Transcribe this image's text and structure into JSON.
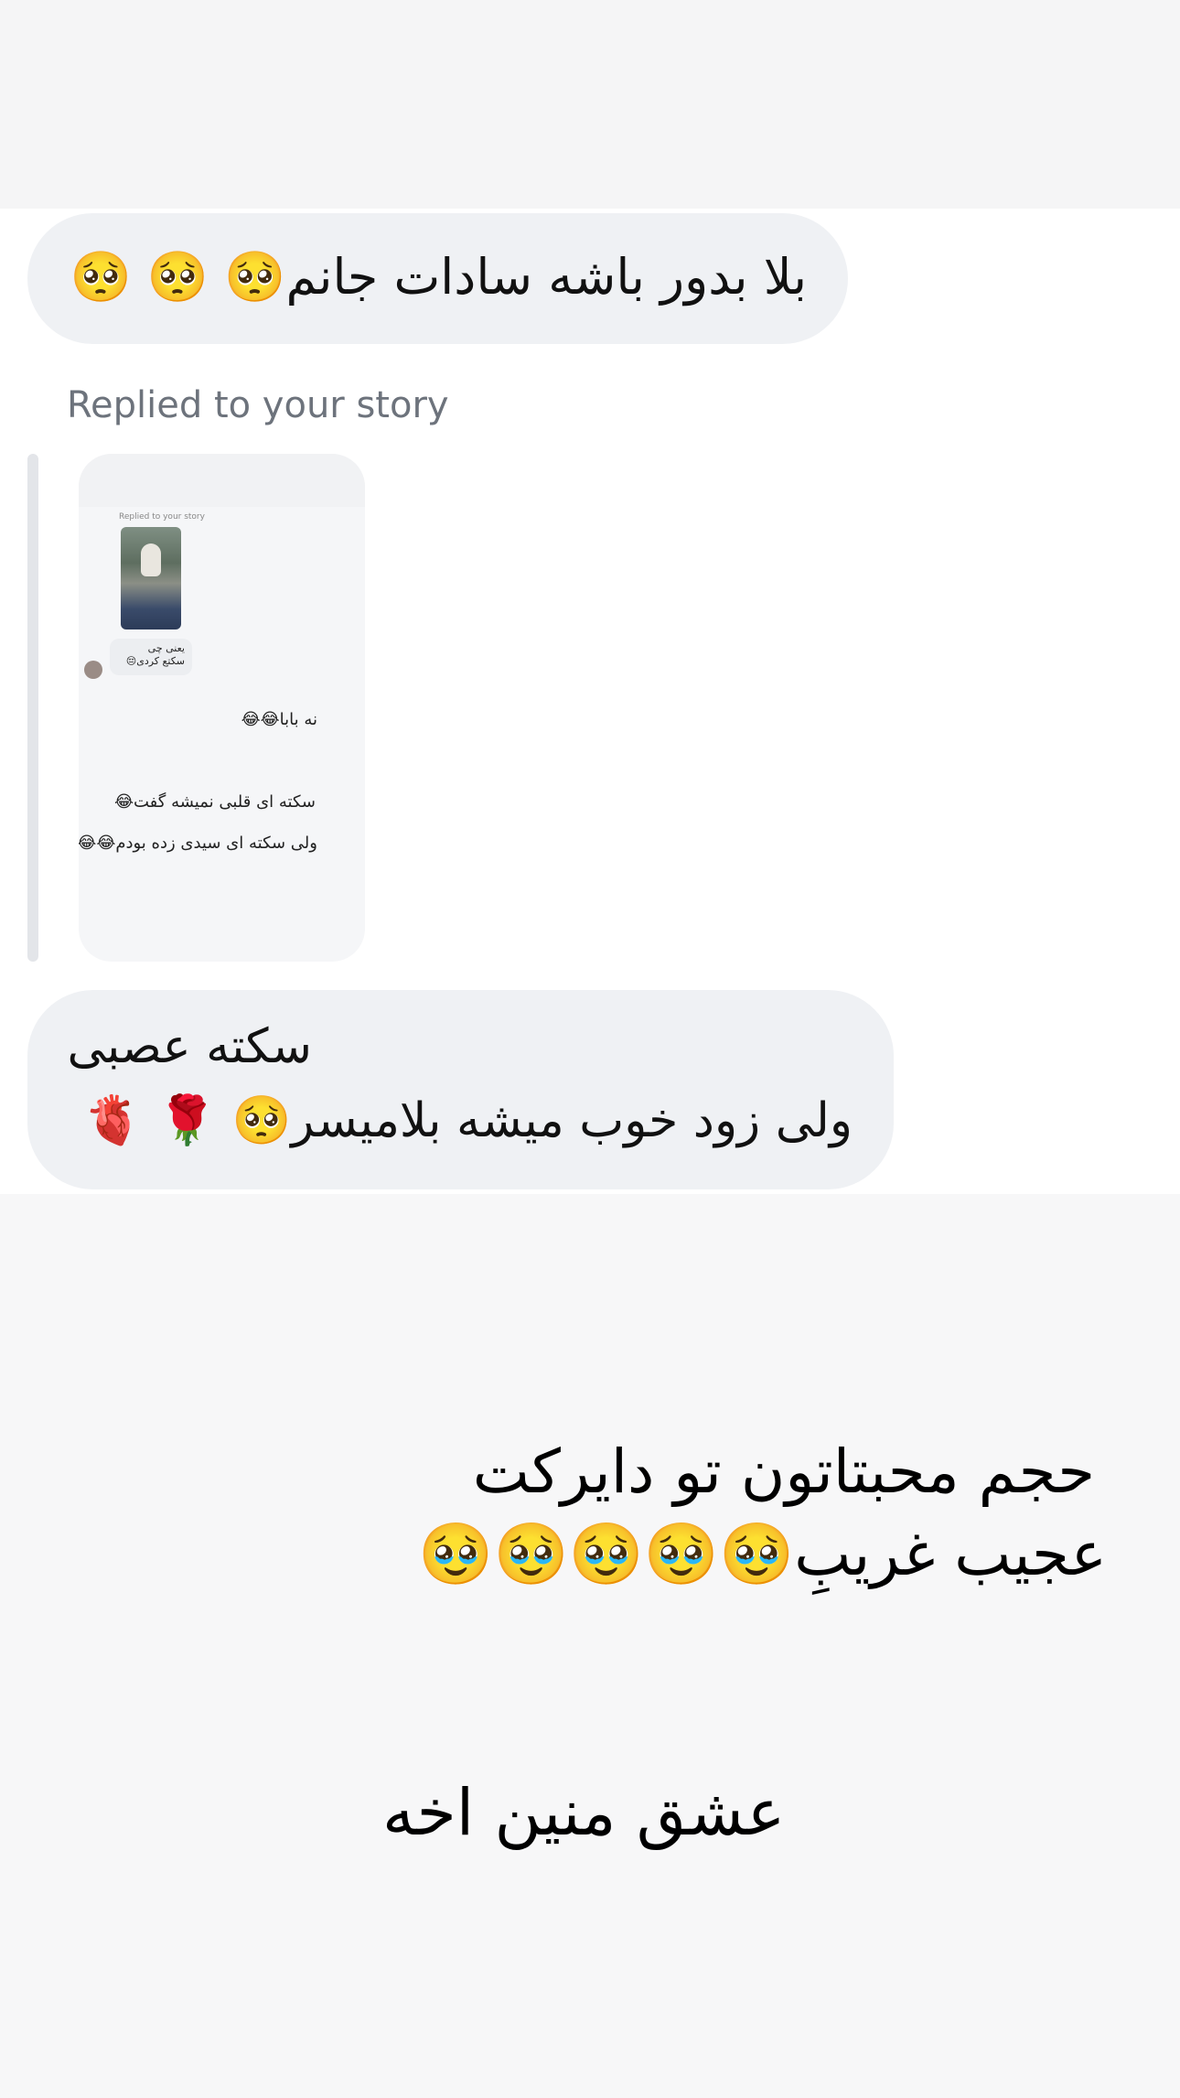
{
  "messages": [
    {
      "text": "بلا بدور باشه سادات جانم🥺 🥺 🥺"
    },
    {
      "line1": "سکته عصبی",
      "line2": "ولی زود خوب میشه بلامیسر🥺 🌹 🫀"
    }
  ],
  "story_reply": {
    "label": "Replied to your story",
    "preview": {
      "replied_label": "Replied to your story",
      "bubble_line1": "یعنی چی",
      "bubble_line2": "سکتع کردی😔",
      "line1": "نه بابا😂😂",
      "line2": "سکته ای قلبی نمیشه گفت😂",
      "line3": "ولی سکته ای سیدی زده بودم😂😂"
    }
  },
  "caption": {
    "line1": "حجم محبتاتون تو دایرکت",
    "line2": "عجیب غریبِ🥹🥹🥹🥹🥹",
    "line3": "عشق منین اخه"
  }
}
